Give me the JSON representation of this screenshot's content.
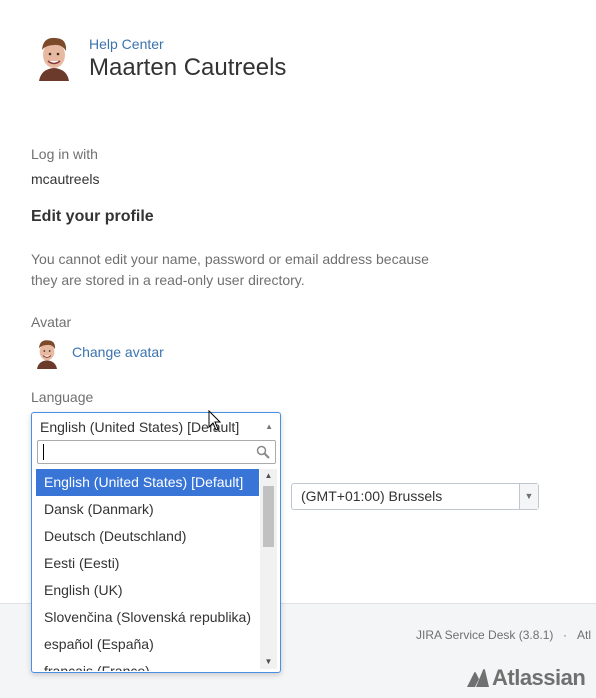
{
  "header": {
    "breadcrumb": "Help Center",
    "title": "Maarten Cautreels"
  },
  "profile": {
    "login_label": "Log in with",
    "login_value": "mcautreels",
    "edit_heading": "Edit your profile",
    "notice": "You cannot edit your name, password or email address because they are stored in a read-only user directory.",
    "avatar_label": "Avatar",
    "change_avatar": "Change avatar",
    "language_label": "Language"
  },
  "language_dropdown": {
    "current": "English (United States) [Default]",
    "search_value": "",
    "options": [
      "English (United States) [Default]",
      "Dansk (Danmark)",
      "Deutsch (Deutschland)",
      "Eesti (Eesti)",
      "English (UK)",
      "Slovenčina (Slovenská republika)",
      "español (España)",
      "français (France)"
    ],
    "selected_index": 0
  },
  "timezone": {
    "value": "(GMT+01:00) Brussels"
  },
  "footer": {
    "version": "JIRA Service Desk (3.8.1)",
    "separator": "·",
    "more": "Atl",
    "logo_text": "Atlassian"
  },
  "colors": {
    "link": "#3b73af",
    "selected_option": "#3875d7",
    "focus_border": "#4a90e2"
  }
}
